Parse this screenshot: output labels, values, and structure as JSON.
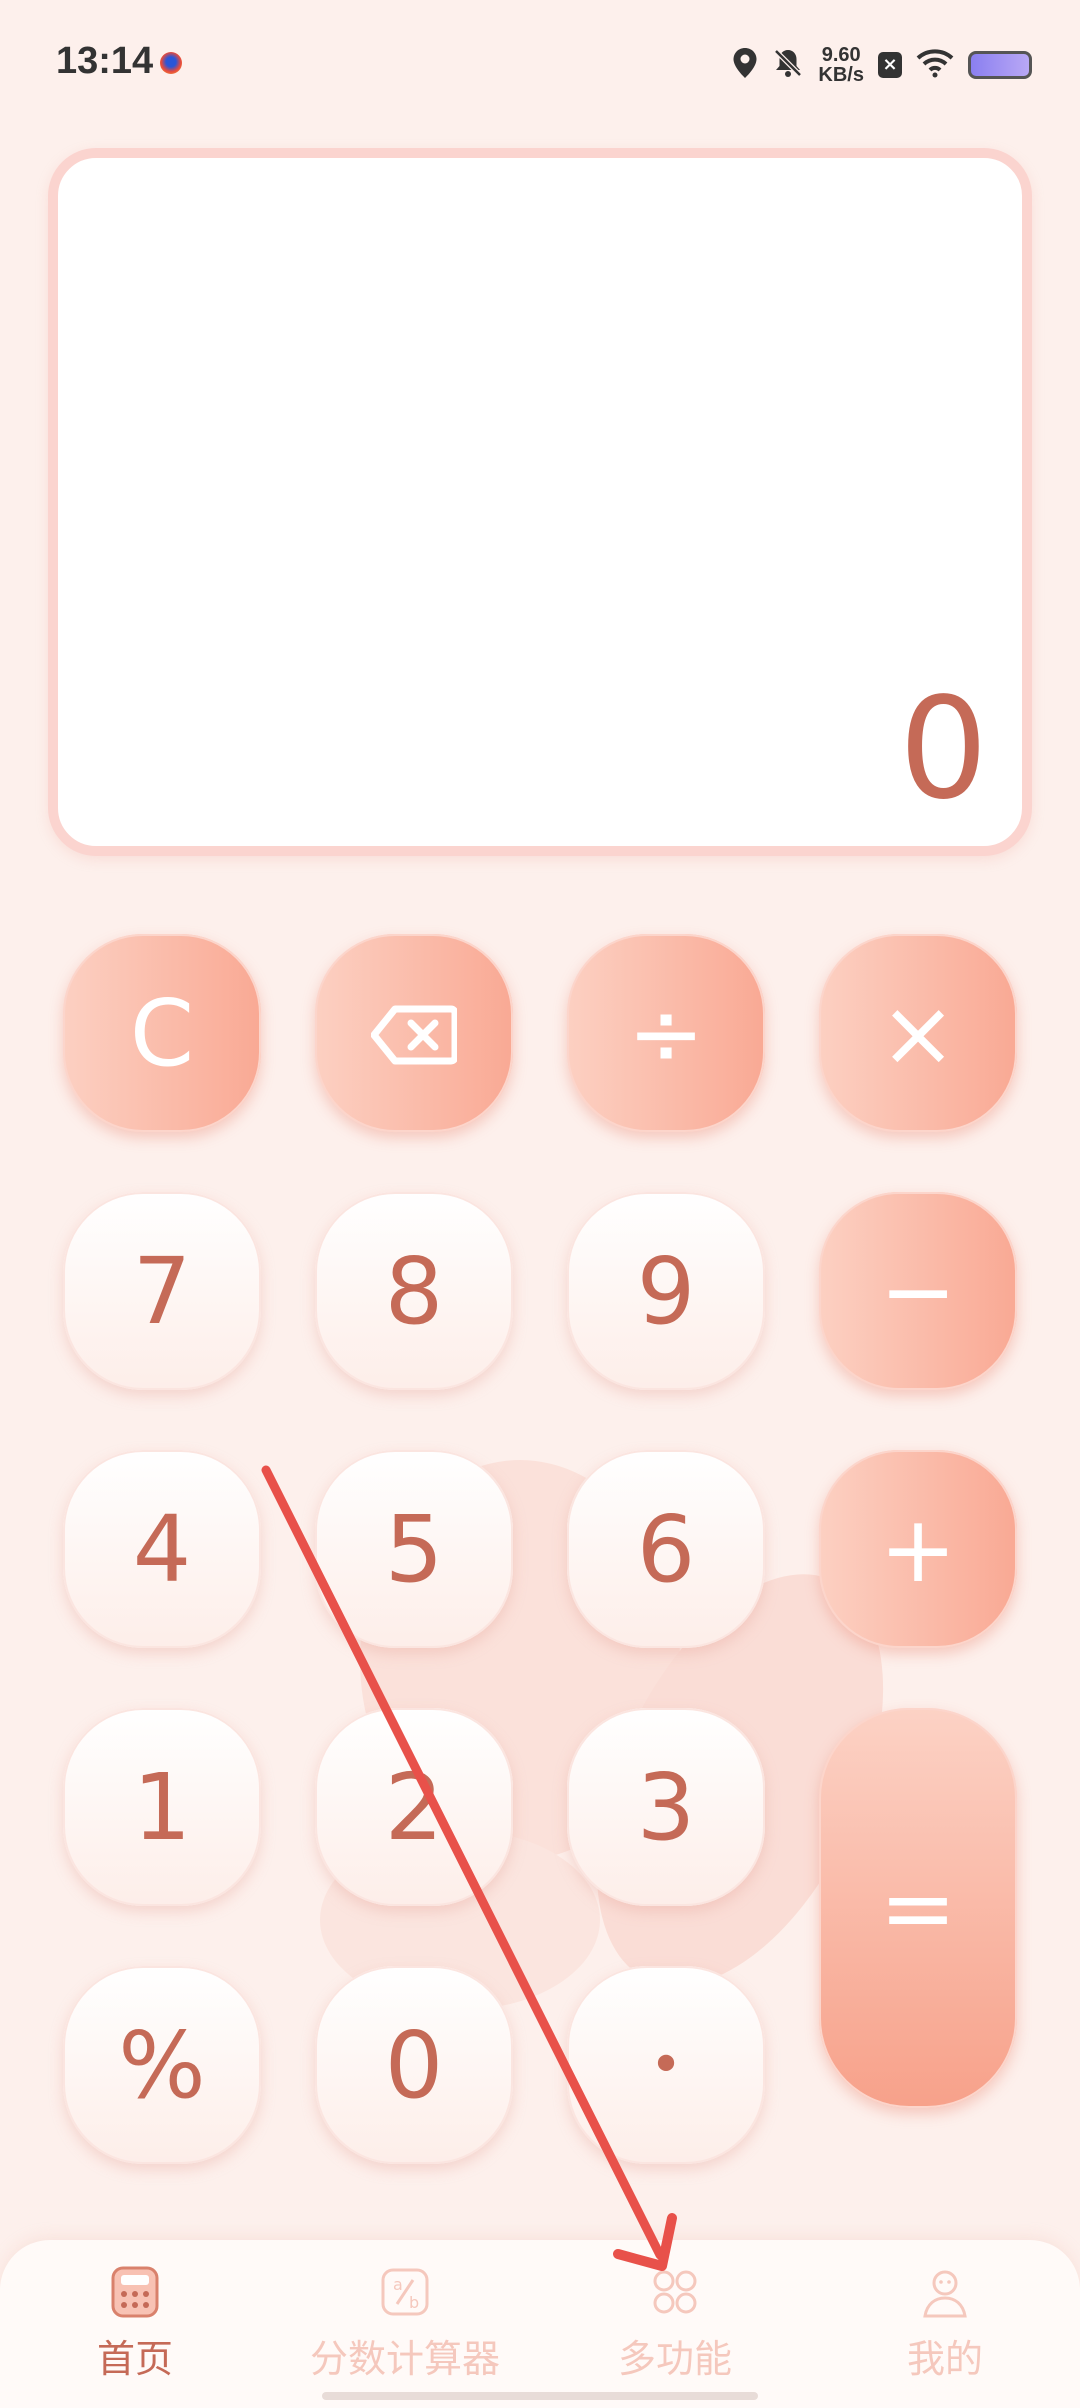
{
  "status": {
    "time": "13:14",
    "net_speed_value": "9.60",
    "net_speed_unit": "KB/s"
  },
  "display": {
    "value": "0"
  },
  "keys": {
    "clear": "C",
    "divide": "÷",
    "multiply": "×",
    "seven": "7",
    "eight": "8",
    "nine": "9",
    "minus": "−",
    "four": "4",
    "five": "5",
    "six": "6",
    "plus": "+",
    "one": "1",
    "two": "2",
    "three": "3",
    "equals": "=",
    "percent": "%",
    "zero": "0",
    "dot": "•"
  },
  "tabs": [
    {
      "label": "首页",
      "icon": "calculator-icon",
      "active": true
    },
    {
      "label": "分数计算器",
      "icon": "fraction-icon",
      "active": false
    },
    {
      "label": "多功能",
      "icon": "grid-icon",
      "active": false
    },
    {
      "label": "我的",
      "icon": "profile-icon",
      "active": false
    }
  ],
  "colors": {
    "accent": "#c56a57",
    "operator_gradient_start": "#fcd0c2",
    "operator_gradient_end": "#f9a994",
    "annotation_arrow": "#e8514a"
  }
}
